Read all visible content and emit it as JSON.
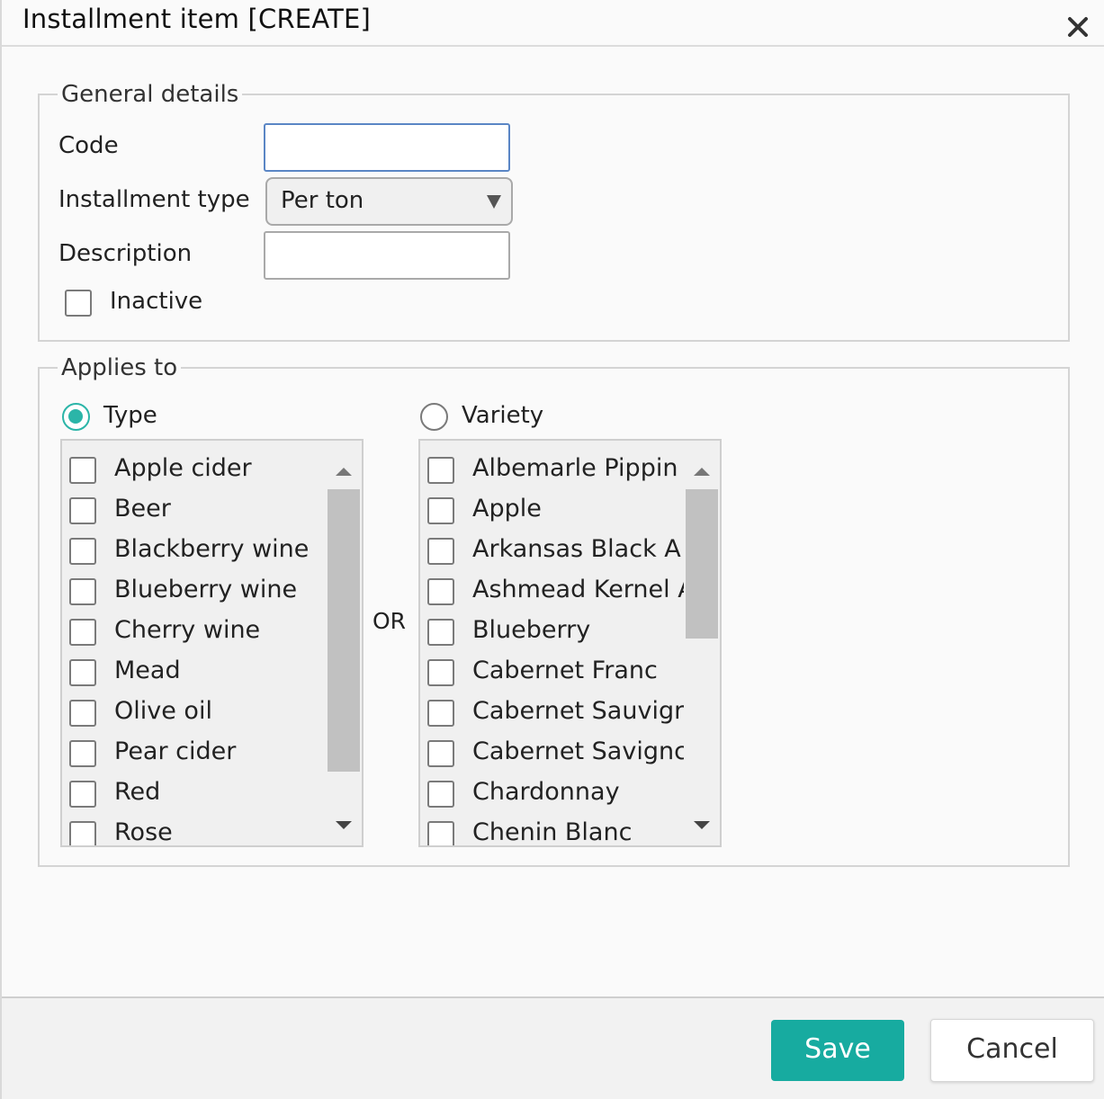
{
  "dialog": {
    "title": "Installment item [CREATE]"
  },
  "general": {
    "legend": "General details",
    "code_label": "Code",
    "code_value": "",
    "installment_type_label": "Installment type",
    "installment_type_value": "Per ton",
    "description_label": "Description",
    "description_value": "",
    "inactive_label": "Inactive",
    "inactive_checked": false
  },
  "applies_to": {
    "legend": "Applies to",
    "type_radio_label": "Type",
    "type_selected": true,
    "or_label": "OR",
    "variety_radio_label": "Variety",
    "variety_selected": false,
    "types": [
      "Apple cider",
      "Beer",
      "Blackberry wine",
      "Blueberry wine",
      "Cherry wine",
      "Mead",
      "Olive oil",
      "Pear cider",
      "Red",
      "Rose"
    ],
    "varieties": [
      "Albemarle Pippin",
      "Apple",
      "Arkansas Black A",
      "Ashmead Kernel A",
      "Blueberry",
      "Cabernet Franc",
      "Cabernet Sauvigr",
      "Cabernet Savignc",
      "Chardonnay",
      "Chenin Blanc"
    ]
  },
  "footer": {
    "save_label": "Save",
    "cancel_label": "Cancel"
  },
  "colors": {
    "accent": "#17aba0",
    "radio_selected": "#2bb5a8",
    "focus_border": "#5a86c5"
  }
}
